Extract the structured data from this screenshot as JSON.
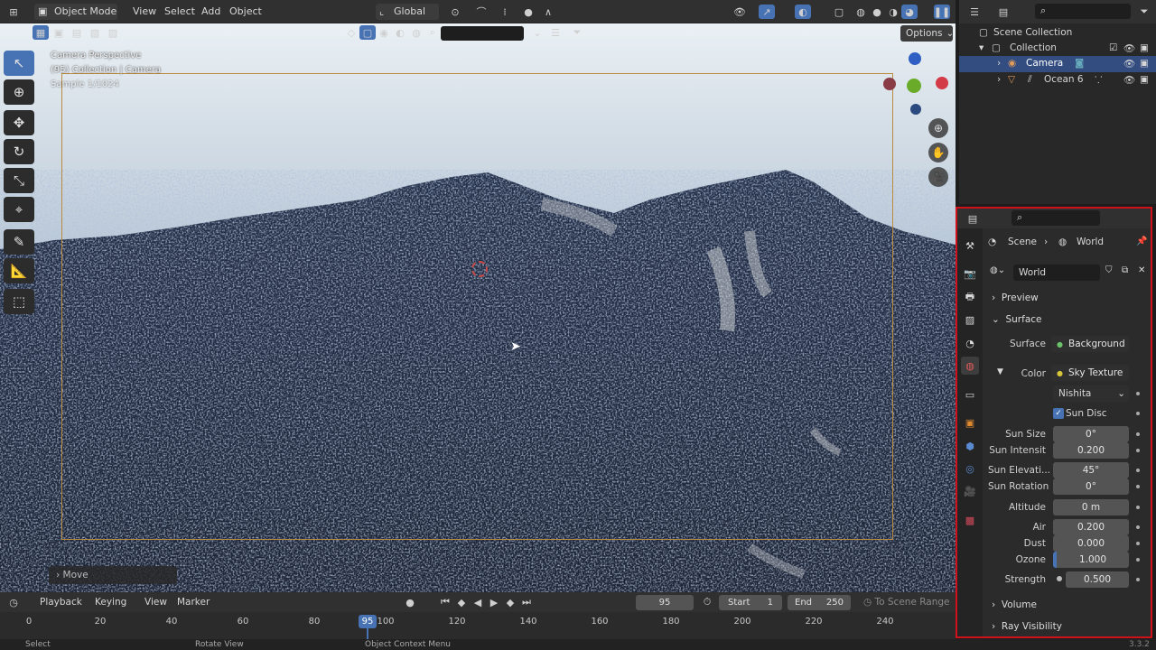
{
  "header": {
    "mode": "Object Mode",
    "menus": [
      "View",
      "Select",
      "Add",
      "Object"
    ],
    "transform_orientation": "Global",
    "options_label": "Options"
  },
  "viewport": {
    "overlay_lines": [
      "Camera Perspective",
      "(95) Collection | Camera",
      "Sample 1/1024"
    ],
    "last_operator": "Move"
  },
  "outliner": {
    "root": "Scene Collection",
    "collection": "Collection",
    "items": [
      "Camera",
      "Ocean 6"
    ]
  },
  "properties": {
    "breadcrumb_scene": "Scene",
    "breadcrumb_world": "World",
    "world_name": "World",
    "panels": {
      "preview": "Preview",
      "surface": "Surface",
      "volume": "Volume",
      "ray_visibility": "Ray Visibility"
    },
    "surface_label": "Surface",
    "surface_value": "Background",
    "color_label": "Color",
    "color_value": "Sky Texture",
    "sky_type": "Nishita",
    "sun_disc_label": "Sun Disc",
    "sun_disc_checked": true,
    "fields": [
      {
        "label": "Sun Size",
        "value": "0°"
      },
      {
        "label": "Sun Intensit",
        "value": "0.200"
      },
      {
        "label": "Sun Elevati...",
        "value": "45°"
      },
      {
        "label": "Sun Rotation",
        "value": "0°"
      },
      {
        "label": "Altitude",
        "value": "0 m"
      },
      {
        "label": "Air",
        "value": "0.200"
      },
      {
        "label": "Dust",
        "value": "0.000"
      },
      {
        "label": "Ozone",
        "value": "1.000"
      },
      {
        "label": "Strength",
        "value": "0.500"
      }
    ]
  },
  "timeline": {
    "menus": [
      "Playback",
      "Keying",
      "View",
      "Marker"
    ],
    "current_frame": "95",
    "start_label": "Start",
    "start_value": "1",
    "end_label": "End",
    "end_value": "250",
    "scene_range": "To Scene Range",
    "ticks": [
      "0",
      "20",
      "40",
      "60",
      "80",
      "100",
      "120",
      "140",
      "160",
      "180",
      "200",
      "220",
      "240"
    ],
    "playhead": "95"
  },
  "status": {
    "items": [
      "Select",
      "Rotate View",
      "Object Context Menu"
    ],
    "version": "3.3.2"
  },
  "colors": {
    "accent": "#4772b3",
    "frame_border": "#d0101b",
    "selection": "#334d80"
  }
}
